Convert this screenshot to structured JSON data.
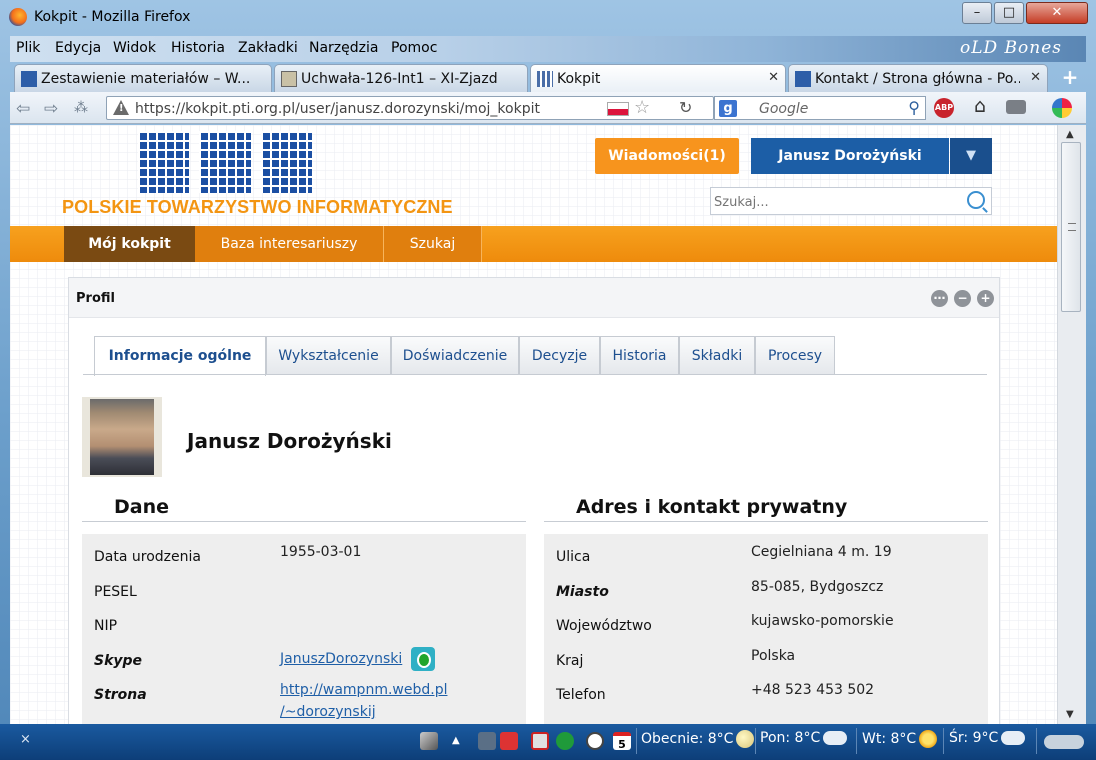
{
  "window": {
    "title": "Kokpit - Mozilla Firefox",
    "controls": {
      "minimize": "–",
      "maximize": "□",
      "close": "✕"
    }
  },
  "menubar": {
    "items": [
      "Plik",
      "Edycja",
      "Widok",
      "Historia",
      "Zakładki",
      "Narzędzia",
      "Pomoc"
    ],
    "persona_label": "oLD Bones"
  },
  "tabs": [
    {
      "label": "Zestawienie materiałów – W...",
      "close": "✕",
      "active": false
    },
    {
      "label": "Uchwała-126-Int1 – XI-Zjazd",
      "close": "✕",
      "active": false
    },
    {
      "label": "Kokpit",
      "close": "✕",
      "active": true
    },
    {
      "label": "Kontakt / Strona główna - Po...",
      "close": "✕",
      "active": false
    }
  ],
  "newtab_label": "+",
  "navbar": {
    "url": "https://kokpit.pti.org.pl/user/janusz.dorozynski/moj_kokpit",
    "search_engine_letter": "g",
    "search_placeholder": "Google",
    "abp_label": "ABP"
  },
  "site": {
    "org_name": "POLSKIE TOWARZYSTWO INFORMATYCZNE",
    "messages_button": "Wiadomości(1)",
    "user_button": "Janusz Dorożyński",
    "search_placeholder": "Szukaj...",
    "nav": [
      "Mój kokpit",
      "Baza interesariuszy",
      "Szukaj"
    ]
  },
  "panel": {
    "title": "Profil",
    "controls": [
      "⋯",
      "−",
      "+"
    ],
    "subtabs": [
      "Informacje ogólne",
      "Wykształcenie",
      "Doświadczenie",
      "Decyzje",
      "Historia",
      "Składki",
      "Procesy"
    ],
    "person_name": "Janusz Dorożyński"
  },
  "dane": {
    "title": "Dane",
    "rows": [
      {
        "label": "Data urodzenia",
        "value": "1955-03-01"
      },
      {
        "label": "PESEL",
        "value": ""
      },
      {
        "label": "NIP",
        "value": ""
      },
      {
        "label": "Skype",
        "value": "JanuszDorozynski"
      },
      {
        "label": "Strona",
        "value": "http://wampnm.webd.pl",
        "value2": "/~dorozynskij"
      }
    ]
  },
  "adres": {
    "title": "Adres i kontakt prywatny",
    "rows": [
      {
        "label": "Ulica",
        "value": "Cegielniana 4 m. 19"
      },
      {
        "label": "Miasto",
        "value": "85-085, Bydgoszcz"
      },
      {
        "label": "Województwo",
        "value": "kujawsko-pomorskie"
      },
      {
        "label": "Kraj",
        "value": "Polska"
      },
      {
        "label": "Telefon",
        "value": "+48 523 453 502"
      }
    ]
  },
  "taskbar": {
    "close_label": "×",
    "calendar_day": "5",
    "weather": [
      {
        "label": "Obecnie: 8°C"
      },
      {
        "label": "Pon: 8°C"
      },
      {
        "label": "Wt: 8°C"
      },
      {
        "label": "Śr: 9°C"
      }
    ]
  },
  "colors": {
    "accent_orange": "#f7941d",
    "brand_blue": "#1c5ea6",
    "nav_active": "#7a4a12"
  }
}
